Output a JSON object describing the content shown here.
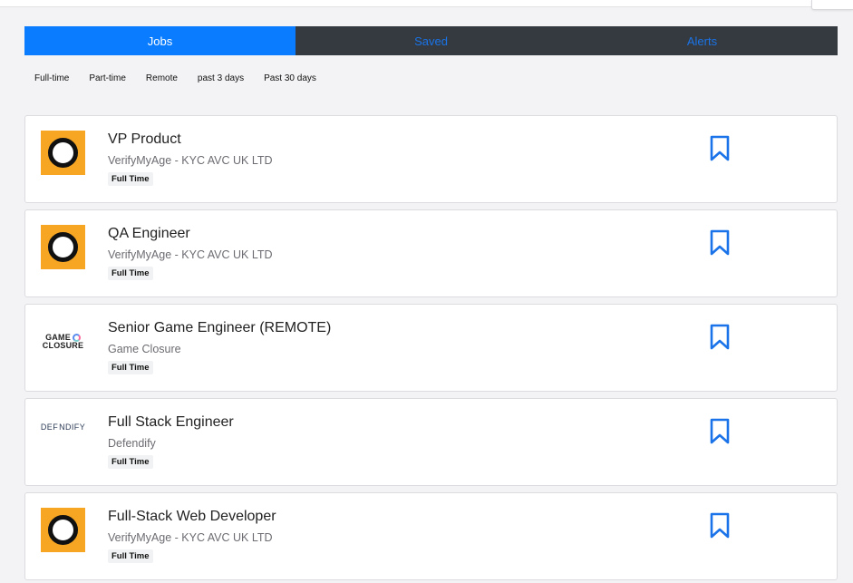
{
  "tabs": [
    {
      "label": "Jobs",
      "active": true
    },
    {
      "label": "Saved",
      "active": false
    },
    {
      "label": "Alerts",
      "active": false
    }
  ],
  "filters": [
    "Full-time",
    "Part-time",
    "Remote",
    "past 3 days",
    "Past 30 days"
  ],
  "colors": {
    "tab_active": "#0a7cff",
    "tab_bar": "#343a40",
    "accent": "#1a73e8",
    "logo_orange": "#f6a623"
  },
  "jobs": [
    {
      "title": "VP Product",
      "company": "VerifyMyAge - KYC AVC UK LTD",
      "type": "Full Time",
      "logo": "verifymyage-logo"
    },
    {
      "title": "QA Engineer",
      "company": "VerifyMyAge - KYC AVC UK LTD",
      "type": "Full Time",
      "logo": "verifymyage-logo"
    },
    {
      "title": "Senior Game Engineer (REMOTE)",
      "company": "Game Closure",
      "type": "Full Time",
      "logo": "game-closure-logo"
    },
    {
      "title": "Full Stack Engineer",
      "company": "Defendify",
      "type": "Full Time",
      "logo": "defendify-logo"
    },
    {
      "title": "Full-Stack Web Developer",
      "company": "VerifyMyAge - KYC AVC UK LTD",
      "type": "Full Time",
      "logo": "verifymyage-logo"
    }
  ],
  "logos": {
    "game_closure": [
      "GAME",
      "CLOSURE"
    ],
    "defendify": [
      "DEF",
      "NDIFY"
    ]
  },
  "icons": {
    "bookmark": "bookmark-icon"
  }
}
